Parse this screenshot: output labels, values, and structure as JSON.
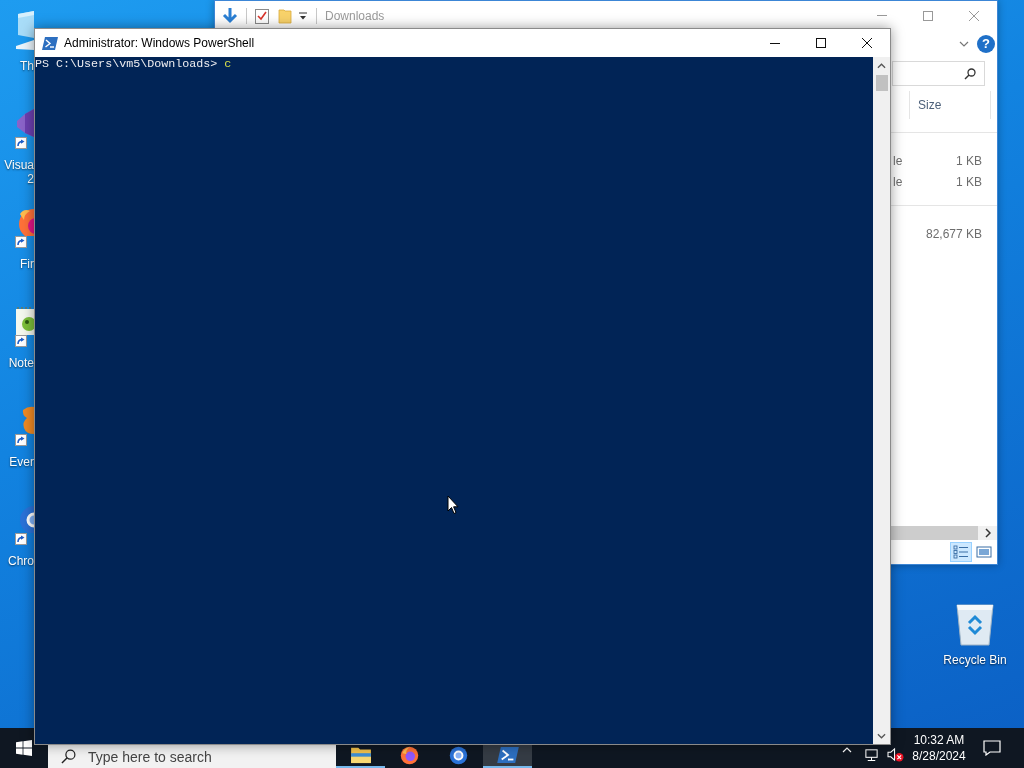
{
  "desktop_icons": [
    {
      "kind": "computer",
      "label_lines": [
        "Th"
      ],
      "shortcut": false
    },
    {
      "kind": "ribbon",
      "label_lines": [
        "Visua",
        "2"
      ],
      "shortcut": true
    },
    {
      "kind": "fox",
      "label_lines": [
        "Fir"
      ],
      "shortcut": true
    },
    {
      "kind": "notepad",
      "label_lines": [
        "Note"
      ],
      "shortcut": true
    },
    {
      "kind": "elephant",
      "label_lines": [
        "Ever"
      ],
      "shortcut": true
    },
    {
      "kind": "ring",
      "label_lines": [
        "Chro"
      ],
      "shortcut": true
    }
  ],
  "explorer": {
    "title": "Downloads",
    "help": "?",
    "size_header": "Size",
    "groups": [
      {
        "rows": [
          {
            "column_1": "le",
            "size": "1 KB"
          },
          {
            "column_1": "le",
            "size": "1 KB"
          }
        ]
      },
      {
        "rows": [
          {
            "size": "82,677 KB"
          }
        ]
      }
    ],
    "views": [
      {
        "kind": "details",
        "selected": true
      },
      {
        "kind": "large_icons",
        "selected": false
      }
    ]
  },
  "powershell": {
    "title": "Administrator: Windows PowerShell",
    "lines": [
      {
        "prompt": "PS C:\\Users\\vm5\\Downloads>",
        "command": "c"
      }
    ]
  },
  "recycle_bin": {
    "label": "Recycle Bin"
  },
  "taskbar": {
    "search": {
      "placeholder": "Type here to search"
    },
    "apps": [
      {
        "kind": "folder",
        "running": true,
        "selected": false
      },
      {
        "kind": "fox",
        "running": false,
        "selected": false
      },
      {
        "kind": "ring",
        "running": false,
        "selected": false
      },
      {
        "kind": "terminal",
        "running": true,
        "selected": true
      }
    ],
    "sound_error": true,
    "clock": {
      "time": "10:32 AM",
      "date": "8/28/2024"
    }
  }
}
